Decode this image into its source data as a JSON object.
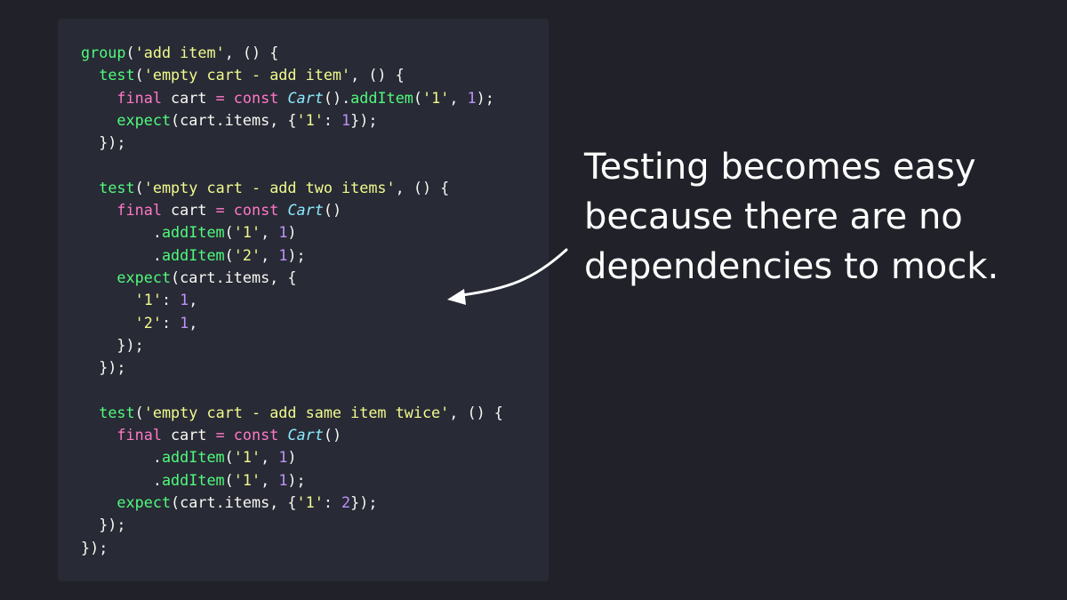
{
  "code": {
    "lines": [
      [
        [
          "group",
          "fn"
        ],
        [
          "(",
          "pl"
        ],
        [
          "'add item'",
          "str"
        ],
        [
          ", () {",
          "pl"
        ]
      ],
      [
        [
          "  ",
          "pl"
        ],
        [
          "test",
          "fn"
        ],
        [
          "(",
          "pl"
        ],
        [
          "'empty cart - add item'",
          "str"
        ],
        [
          ", () {",
          "pl"
        ]
      ],
      [
        [
          "    ",
          "pl"
        ],
        [
          "final",
          "kw"
        ],
        [
          " cart ",
          "pl"
        ],
        [
          "=",
          "kw"
        ],
        [
          " ",
          "pl"
        ],
        [
          "const",
          "kw"
        ],
        [
          " ",
          "pl"
        ],
        [
          "Cart",
          "cls"
        ],
        [
          "().",
          "pl"
        ],
        [
          "addItem",
          "fn"
        ],
        [
          "(",
          "pl"
        ],
        [
          "'1'",
          "str"
        ],
        [
          ", ",
          "pl"
        ],
        [
          "1",
          "num"
        ],
        [
          ");",
          "pl"
        ]
      ],
      [
        [
          "    ",
          "pl"
        ],
        [
          "expect",
          "fn"
        ],
        [
          "(cart.items, {",
          "pl"
        ],
        [
          "'1'",
          "str"
        ],
        [
          ": ",
          "pl"
        ],
        [
          "1",
          "num"
        ],
        [
          "});",
          "pl"
        ]
      ],
      [
        [
          "  });",
          "pl"
        ]
      ],
      [
        [
          "",
          "pl"
        ]
      ],
      [
        [
          "  ",
          "pl"
        ],
        [
          "test",
          "fn"
        ],
        [
          "(",
          "pl"
        ],
        [
          "'empty cart - add two items'",
          "str"
        ],
        [
          ", () {",
          "pl"
        ]
      ],
      [
        [
          "    ",
          "pl"
        ],
        [
          "final",
          "kw"
        ],
        [
          " cart ",
          "pl"
        ],
        [
          "=",
          "kw"
        ],
        [
          " ",
          "pl"
        ],
        [
          "const",
          "kw"
        ],
        [
          " ",
          "pl"
        ],
        [
          "Cart",
          "cls"
        ],
        [
          "()",
          "pl"
        ]
      ],
      [
        [
          "        .",
          "pl"
        ],
        [
          "addItem",
          "fn"
        ],
        [
          "(",
          "pl"
        ],
        [
          "'1'",
          "str"
        ],
        [
          ", ",
          "pl"
        ],
        [
          "1",
          "num"
        ],
        [
          ")",
          "pl"
        ]
      ],
      [
        [
          "        .",
          "pl"
        ],
        [
          "addItem",
          "fn"
        ],
        [
          "(",
          "pl"
        ],
        [
          "'2'",
          "str"
        ],
        [
          ", ",
          "pl"
        ],
        [
          "1",
          "num"
        ],
        [
          ");",
          "pl"
        ]
      ],
      [
        [
          "    ",
          "pl"
        ],
        [
          "expect",
          "fn"
        ],
        [
          "(cart.items, {",
          "pl"
        ]
      ],
      [
        [
          "      ",
          "pl"
        ],
        [
          "'1'",
          "str"
        ],
        [
          ": ",
          "pl"
        ],
        [
          "1",
          "num"
        ],
        [
          ",",
          "pl"
        ]
      ],
      [
        [
          "      ",
          "pl"
        ],
        [
          "'2'",
          "str"
        ],
        [
          ": ",
          "pl"
        ],
        [
          "1",
          "num"
        ],
        [
          ",",
          "pl"
        ]
      ],
      [
        [
          "    });",
          "pl"
        ]
      ],
      [
        [
          "  });",
          "pl"
        ]
      ],
      [
        [
          "",
          "pl"
        ]
      ],
      [
        [
          "  ",
          "pl"
        ],
        [
          "test",
          "fn"
        ],
        [
          "(",
          "pl"
        ],
        [
          "'empty cart - add same item twice'",
          "str"
        ],
        [
          ", () {",
          "pl"
        ]
      ],
      [
        [
          "    ",
          "pl"
        ],
        [
          "final",
          "kw"
        ],
        [
          " cart ",
          "pl"
        ],
        [
          "=",
          "kw"
        ],
        [
          " ",
          "pl"
        ],
        [
          "const",
          "kw"
        ],
        [
          " ",
          "pl"
        ],
        [
          "Cart",
          "cls"
        ],
        [
          "()",
          "pl"
        ]
      ],
      [
        [
          "        .",
          "pl"
        ],
        [
          "addItem",
          "fn"
        ],
        [
          "(",
          "pl"
        ],
        [
          "'1'",
          "str"
        ],
        [
          ", ",
          "pl"
        ],
        [
          "1",
          "num"
        ],
        [
          ")",
          "pl"
        ]
      ],
      [
        [
          "        .",
          "pl"
        ],
        [
          "addItem",
          "fn"
        ],
        [
          "(",
          "pl"
        ],
        [
          "'1'",
          "str"
        ],
        [
          ", ",
          "pl"
        ],
        [
          "1",
          "num"
        ],
        [
          ");",
          "pl"
        ]
      ],
      [
        [
          "    ",
          "pl"
        ],
        [
          "expect",
          "fn"
        ],
        [
          "(cart.items, {",
          "pl"
        ],
        [
          "'1'",
          "str"
        ],
        [
          ": ",
          "pl"
        ],
        [
          "2",
          "num"
        ],
        [
          "});",
          "pl"
        ]
      ],
      [
        [
          "  });",
          "pl"
        ]
      ],
      [
        [
          "});",
          "pl"
        ]
      ]
    ]
  },
  "caption": {
    "lines": [
      "Testing becomes easy",
      "because there are no",
      "dependencies to mock."
    ]
  },
  "colors": {
    "background": "#212229",
    "panel": "#282a36",
    "function": "#50fa7b",
    "string": "#f1fa8c",
    "keyword": "#ff79c6",
    "class": "#8be9fd",
    "number": "#bd93f9",
    "text": "#f8f8f2"
  },
  "arrow": {
    "icon": "curved-arrow-left-icon"
  }
}
